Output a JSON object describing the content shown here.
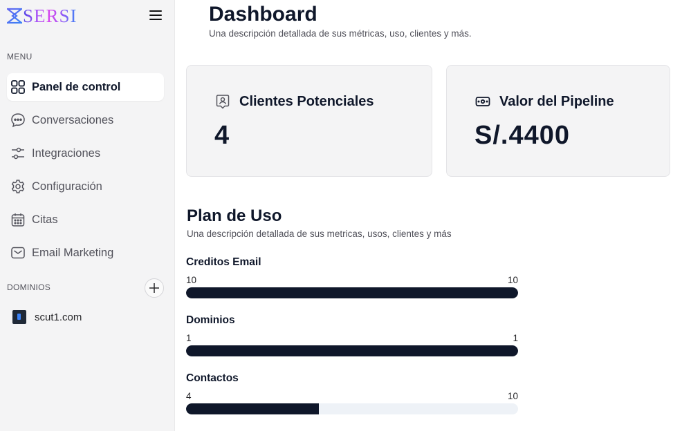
{
  "brand": {
    "name": "SERSI"
  },
  "sidebar": {
    "menu_label": "MENU",
    "items": [
      {
        "label": "Panel de control",
        "icon": "grid-icon",
        "active": true
      },
      {
        "label": "Conversaciones",
        "icon": "chat-bubble-icon",
        "active": false
      },
      {
        "label": "Integraciones",
        "icon": "sliders-icon",
        "active": false
      },
      {
        "label": "Configuración",
        "icon": "gear-icon",
        "active": false
      },
      {
        "label": "Citas",
        "icon": "calendar-icon",
        "active": false
      },
      {
        "label": "Email Marketing",
        "icon": "mail-icon",
        "active": false
      }
    ],
    "domains_label": "DOMINIOS",
    "domains": [
      {
        "label": "scut1.com"
      }
    ]
  },
  "header": {
    "title": "Dashboard",
    "description": "Una descripción detallada de sus métricas, uso, clientes y más."
  },
  "cards": {
    "leads": {
      "title": "Clientes Potenciales",
      "value": "4",
      "icon": "contact-badge-icon"
    },
    "pipeline": {
      "title": "Valor del Pipeline",
      "value": "S/.4400",
      "icon": "money-icon"
    }
  },
  "usage": {
    "title": "Plan de Uso",
    "description": "Una descripción detallada de sus metricas, usos, clientes y más",
    "items": [
      {
        "label": "Creditos Email",
        "used": "10",
        "limit": "10",
        "fraction": 1.0
      },
      {
        "label": "Dominios",
        "used": "1",
        "limit": "1",
        "fraction": 1.0
      },
      {
        "label": "Contactos",
        "used": "4",
        "limit": "10",
        "fraction": 0.4
      }
    ]
  },
  "colors": {
    "accent": "#0f172a",
    "sidebar_bg": "#f4f4f5",
    "bar_track": "#eef2f7"
  }
}
